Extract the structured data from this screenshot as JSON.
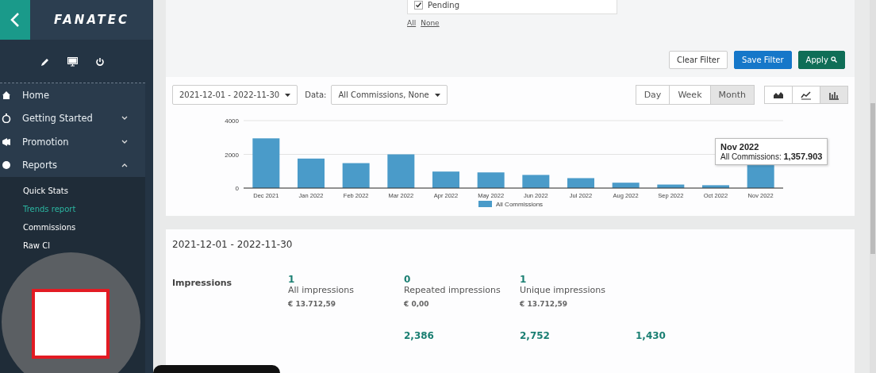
{
  "sidebar": {
    "logo": "FANATEC",
    "nav": [
      {
        "label": "Home"
      },
      {
        "label": "Getting Started",
        "expanded": false
      },
      {
        "label": "Promotion",
        "expanded": false
      },
      {
        "label": "Reports",
        "expanded": true,
        "children": [
          {
            "label": "Quick Stats",
            "selected": false
          },
          {
            "label": "Trends report",
            "selected": true
          },
          {
            "label": "Commissions",
            "selected": false
          },
          {
            "label": "Raw Cl",
            "selected": false
          }
        ]
      }
    ]
  },
  "filter": {
    "options": [
      {
        "label": "Pending",
        "checked": true
      }
    ],
    "links": [
      "All",
      "None"
    ],
    "buttons": [
      {
        "label": "Clear Filter",
        "kind": "default"
      },
      {
        "label": "Save Filter",
        "kind": "primary"
      },
      {
        "label": "Apply",
        "kind": "success"
      }
    ]
  },
  "toolbar": {
    "date_range": "2021-12-01 - 2022-11-30",
    "data_label": "Data:",
    "data_value": "All Commissions, None",
    "periods": [
      {
        "label": "Day",
        "selected": false
      },
      {
        "label": "Week",
        "selected": false
      },
      {
        "label": "Month",
        "selected": true
      }
    ],
    "chart_types": [
      {
        "kind": "area",
        "selected": false
      },
      {
        "kind": "line",
        "selected": false
      },
      {
        "kind": "bar",
        "selected": true
      }
    ]
  },
  "chart": {
    "chart_data": {
      "type": "bar",
      "categories": [
        "Dec 2021",
        "Jan 2022",
        "Feb 2022",
        "Mar 2022",
        "Apr 2022",
        "May 2022",
        "Jun 2022",
        "Jul 2022",
        "Aug 2022",
        "Sep 2022",
        "Oct 2022",
        "Nov 2022"
      ],
      "series": [
        {
          "name": "All Commissions",
          "color": "#4a9bc9",
          "values": [
            2950,
            1750,
            1480,
            2000,
            980,
            930,
            780,
            590,
            320,
            210,
            170,
            1358
          ]
        }
      ],
      "ylim": [
        0,
        4000
      ],
      "yticks": [
        0,
        2000,
        4000
      ]
    },
    "tooltip": {
      "title": "Nov 2022",
      "label": "All Commissions:",
      "value": "1,357.903"
    }
  },
  "stats": {
    "title": "2021-12-01 - 2022-11-30",
    "rows": [
      {
        "label": "Impressions",
        "cells": [
          {
            "value": "1",
            "caption": "All impressions",
            "amount": "€ 13.712,59"
          },
          {
            "value": "0",
            "caption": "Repeated impressions",
            "amount": "€ 0,00"
          },
          {
            "value": "1",
            "caption": "Unique impressions",
            "amount": "€ 13.712,59"
          }
        ]
      },
      {
        "cells": [
          "",
          {
            "value": "2,386"
          },
          {
            "value": "2,752"
          },
          {
            "value": "1,430"
          }
        ]
      }
    ]
  }
}
